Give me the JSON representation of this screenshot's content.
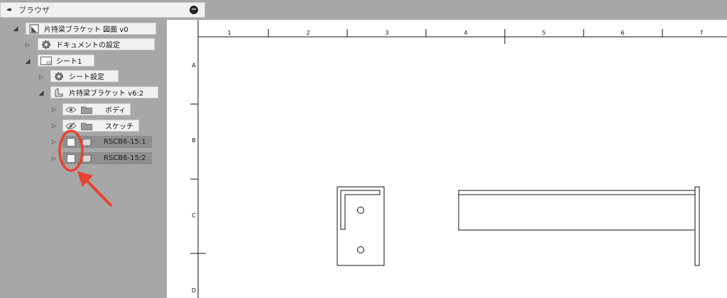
{
  "browser": {
    "collapse_glyph": "◂◂",
    "title": "ブラウザ",
    "close_glyph": "−"
  },
  "tree": {
    "root": "片持梁ブラケット 図面 v0",
    "document_settings": "ドキュメントの設定",
    "sheet": "シート1",
    "sheet_settings": "シート設定",
    "component": "片持梁ブラケット v6:2",
    "bodies": "ボディ",
    "sketches": "スケッチ",
    "view1": "RSCB6-15:1",
    "view2": "RSCB6-15:2"
  },
  "drawing": {
    "columns": [
      "1",
      "2",
      "3",
      "4",
      "5",
      "6",
      "7"
    ],
    "rows": [
      "A",
      "B",
      "C",
      "D"
    ]
  },
  "colors": {
    "panel_bg": "#a7a7a7",
    "highlight": "#e8432e"
  }
}
